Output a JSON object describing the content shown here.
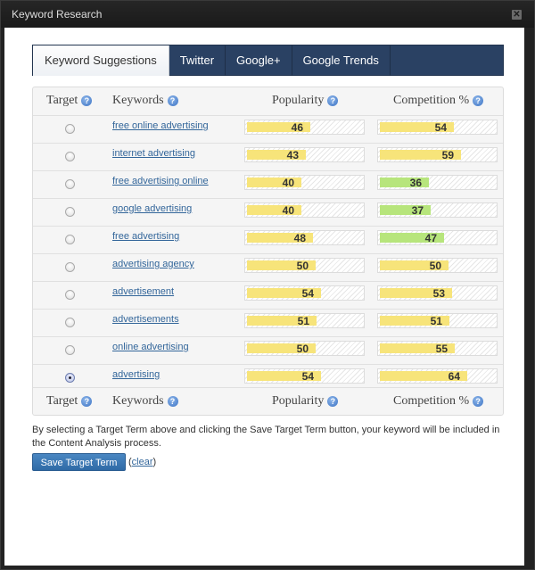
{
  "window": {
    "title": "Keyword Research",
    "close_icon": "close-icon"
  },
  "tabs": [
    {
      "label": "Keyword Suggestions",
      "active": true
    },
    {
      "label": "Twitter",
      "active": false
    },
    {
      "label": "Google+",
      "active": false
    },
    {
      "label": "Google Trends",
      "active": false
    }
  ],
  "table": {
    "headers": {
      "target": "Target",
      "keywords": "Keywords",
      "popularity": "Popularity",
      "competition": "Competition %",
      "help_icon": "?"
    },
    "scale_max": 100,
    "colors": {
      "yellow": "#f7e47a",
      "green": "#b7e57c"
    },
    "rows": [
      {
        "keyword": "free online advertising",
        "popularity": 46,
        "competition": 54,
        "competition_color": "yellow",
        "selected": false
      },
      {
        "keyword": "internet advertising",
        "popularity": 43,
        "competition": 59,
        "competition_color": "yellow",
        "selected": false
      },
      {
        "keyword": "free advertising online",
        "popularity": 40,
        "competition": 36,
        "competition_color": "green",
        "selected": false
      },
      {
        "keyword": "google advertising",
        "popularity": 40,
        "competition": 37,
        "competition_color": "green",
        "selected": false
      },
      {
        "keyword": "free advertising",
        "popularity": 48,
        "competition": 47,
        "competition_color": "green",
        "selected": false
      },
      {
        "keyword": "advertising agency",
        "popularity": 50,
        "competition": 50,
        "competition_color": "yellow",
        "selected": false
      },
      {
        "keyword": "advertisement",
        "popularity": 54,
        "competition": 53,
        "competition_color": "yellow",
        "selected": false
      },
      {
        "keyword": "advertisements",
        "popularity": 51,
        "competition": 51,
        "competition_color": "yellow",
        "selected": false
      },
      {
        "keyword": "online advertising",
        "popularity": 50,
        "competition": 55,
        "competition_color": "yellow",
        "selected": false
      },
      {
        "keyword": "advertising",
        "popularity": 54,
        "competition": 64,
        "competition_color": "yellow",
        "selected": true
      }
    ]
  },
  "note": "By selecting a Target Term above and clicking the Save Target Term button, your keyword will be included in the Content Analysis process.",
  "save_button": "Save Target Term",
  "clear": {
    "open": "(",
    "label": "clear",
    "close": ")"
  }
}
